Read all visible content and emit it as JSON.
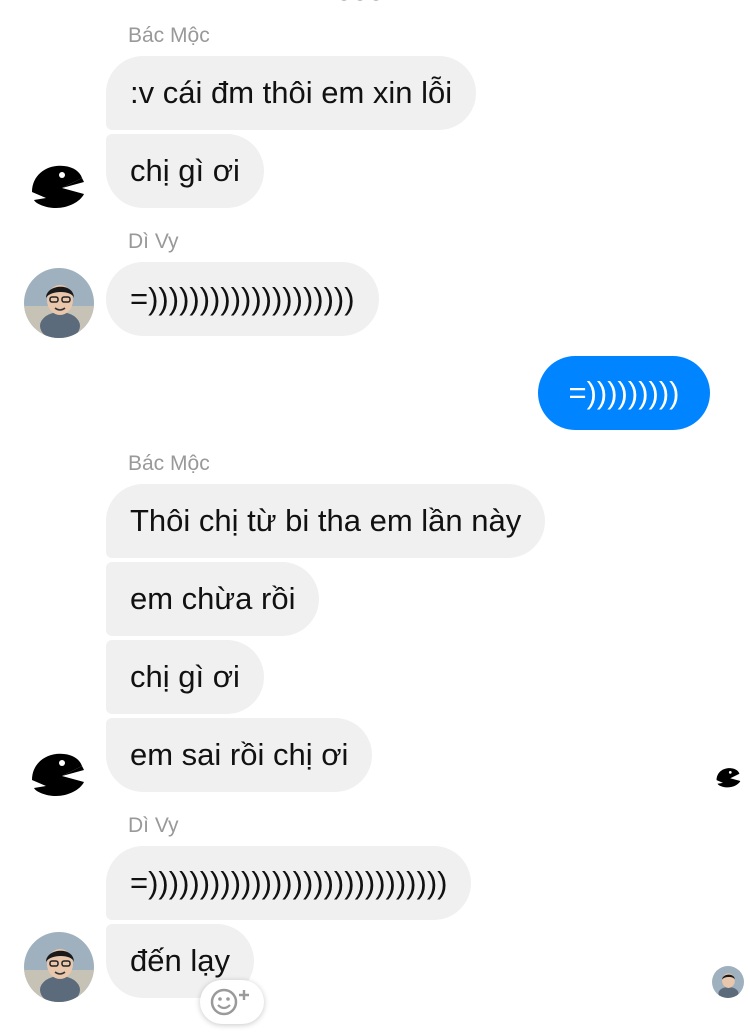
{
  "messages": {
    "group1": {
      "sender": "Bác Mộc",
      "m1": ":v cái đm thôi em xin lỗi",
      "m2": "chị gì ơi"
    },
    "group2": {
      "sender": "Dì Vy",
      "m1": "=))))))))))))))))))))"
    },
    "outgoing": {
      "m1": "=)))))))))"
    },
    "group3": {
      "sender": "Bác Mộc",
      "m1": "Thôi chị từ bi tha em lần này",
      "m2": "em chừa rồi",
      "m3": "chị gì ơi",
      "m4": "em sai rồi chị ơi"
    },
    "group4": {
      "sender": "Dì Vy",
      "m1": "=)))))))))))))))))))))))))))))",
      "m2": "đến lạy"
    }
  },
  "icons": {
    "avatar_bac_moc": "duck-avatar-icon",
    "avatar_di_vy": "profile-photo-avatar",
    "reaction": "smiley-plus-icon"
  },
  "colors": {
    "outgoing_bubble": "#0084ff",
    "incoming_bubble": "#f0f0f0",
    "sender_label": "#999999"
  }
}
